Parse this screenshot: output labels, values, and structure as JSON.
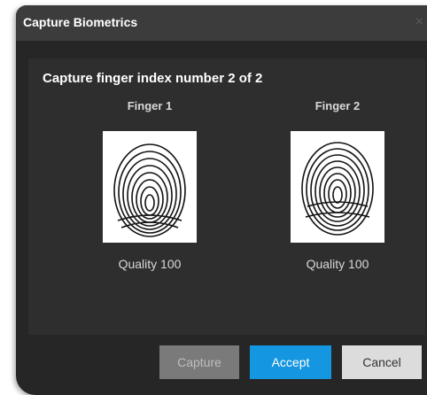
{
  "dialog": {
    "title": "Capture Biometrics",
    "close_glyph": "×",
    "heading": "Capture finger index number 2 of 2"
  },
  "fingers": [
    {
      "label": "Finger 1",
      "quality": "Quality 100",
      "icon": "fingerprint-icon"
    },
    {
      "label": "Finger 2",
      "quality": "Quality 100",
      "icon": "fingerprint-icon"
    }
  ],
  "buttons": {
    "capture": "Capture",
    "accept": "Accept",
    "cancel": "Cancel"
  },
  "colors": {
    "dialog_bg": "#262626",
    "titlebar_bg": "#3c3c3c",
    "panel_bg": "#2e2e2e",
    "accept_blue": "#1496e0",
    "capture_disabled": "#7a7a7a",
    "cancel_bg": "#dcdcdc"
  }
}
